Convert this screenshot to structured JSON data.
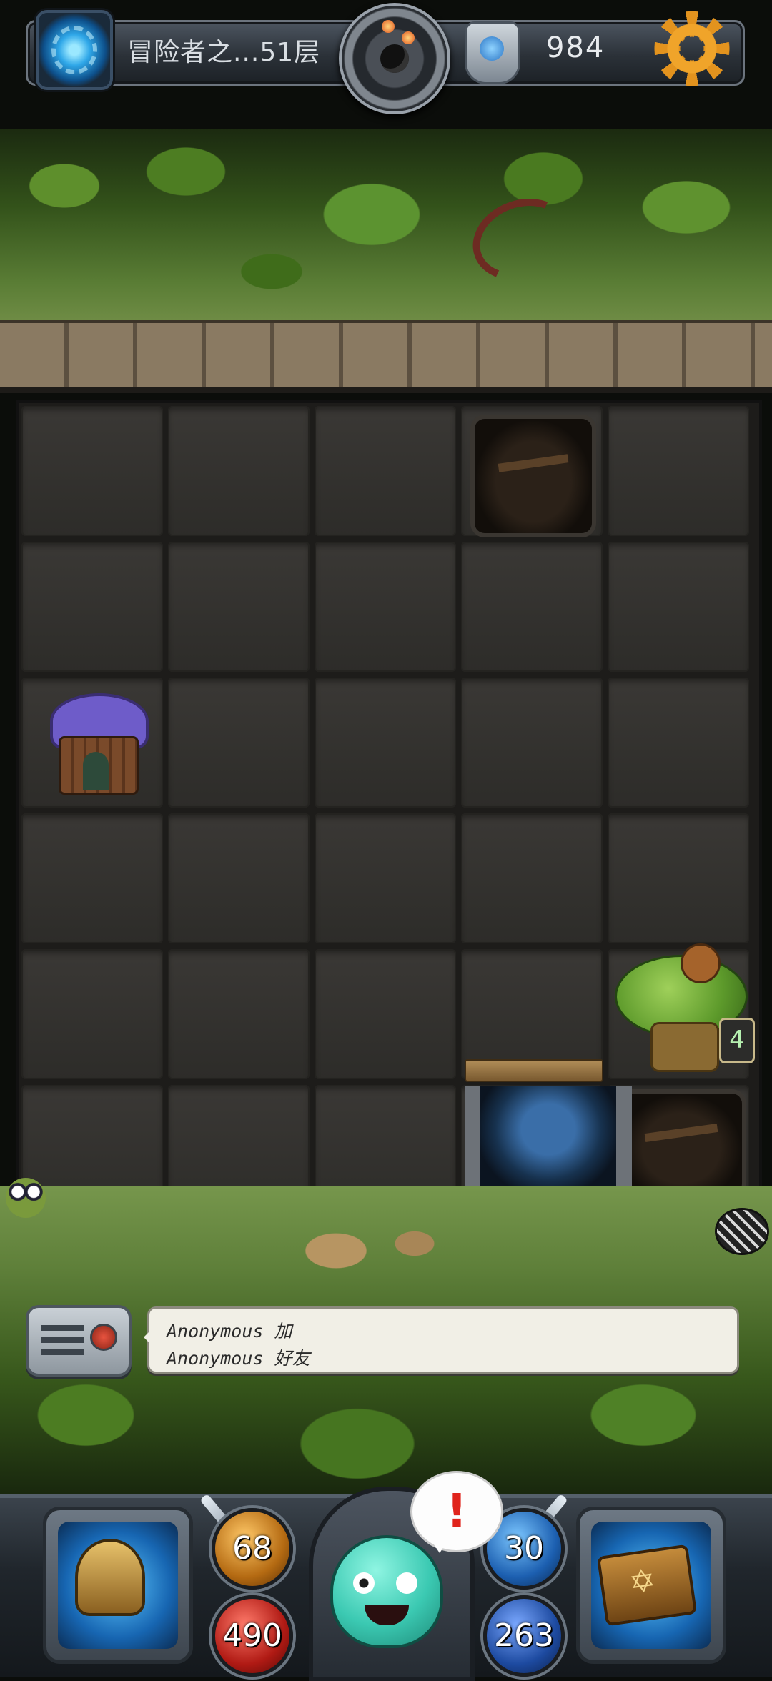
{
  "topbar": {
    "level": "冒险者之...51层",
    "currency": "984",
    "icons": {
      "portal": "portal-icon",
      "bomb": "bomb-icon",
      "shield": "shield-icon",
      "settings": "gear-icon"
    }
  },
  "board": {
    "grid": {
      "columns": 5,
      "rows": 6
    }
  },
  "monster_counter": "4",
  "chat": {
    "lines": [
      {
        "user": "Anonymous",
        "text": "加"
      },
      {
        "user": "Anonymous",
        "text": "好友"
      }
    ]
  },
  "stats": {
    "attack": "68",
    "hp": "490",
    "defense": "30",
    "mana": "263"
  },
  "alert": "!",
  "colors": {
    "accent_gold": "#e3931e",
    "chat_bg": "#f1efe6",
    "alert_red": "#e0241c"
  }
}
